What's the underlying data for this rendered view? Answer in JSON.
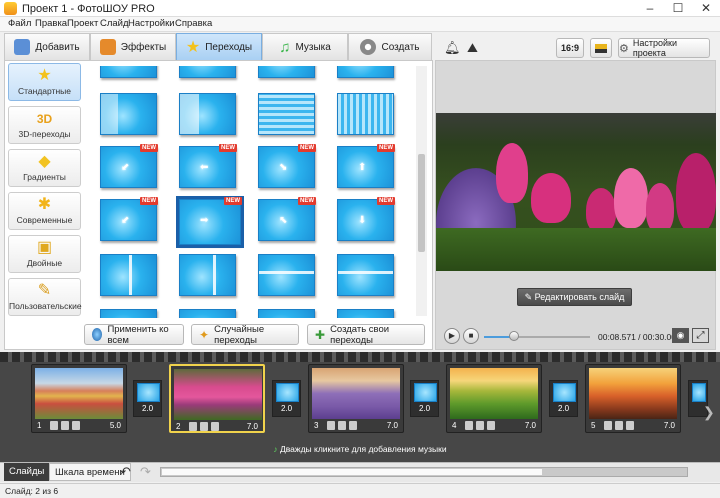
{
  "window": {
    "title": "Проект 1 - ФотоШОУ PRO",
    "minimize": "–",
    "maximize": "☐",
    "close": "✕"
  },
  "menu": [
    "Файл",
    "Правка",
    "Проект",
    "Слайд",
    "Настройки",
    "Справка"
  ],
  "tabs": [
    {
      "label": "Добавить",
      "icon": "add-photo-icon",
      "color": "#5b8fd6"
    },
    {
      "label": "Эффекты",
      "icon": "palette-icon",
      "color": "#e58a2b"
    },
    {
      "label": "Переходы",
      "icon": "star-icon",
      "color": "#f3c21c"
    },
    {
      "label": "Музыка",
      "icon": "music-note-icon",
      "color": "#39b54a"
    },
    {
      "label": "Создать",
      "icon": "film-reel-icon",
      "color": "#8a8a8a"
    }
  ],
  "categories": [
    {
      "label": "Стандартные",
      "icon": "★"
    },
    {
      "label": "3D-переходы",
      "icon": "3D"
    },
    {
      "label": "Градиенты",
      "icon": "◆"
    },
    {
      "label": "Современные",
      "icon": "✱"
    },
    {
      "label": "Двойные",
      "icon": "▣"
    },
    {
      "label": "Пользовательские",
      "icon": "✎"
    }
  ],
  "new_badge": "NEW",
  "transition_buttons": {
    "apply_all": "Применить ко всем",
    "random": "Случайные переходы",
    "create_own": "Создать свои переходы"
  },
  "right_toolbar": {
    "aspect": "16:9",
    "settings": "Настройки проекта"
  },
  "edit_slide": "Редактировать слайд",
  "player": {
    "time": "00:08.571 / 00:30.000",
    "progress": 0.2857
  },
  "slides": [
    {
      "num": "1",
      "duration": "5.0",
      "theme": "houses",
      "transition": "2.0"
    },
    {
      "num": "2",
      "duration": "7.0",
      "theme": "tulips",
      "transition": "2.0",
      "selected": true
    },
    {
      "num": "3",
      "duration": "7.0",
      "theme": "lavender",
      "transition": "2.0"
    },
    {
      "num": "4",
      "duration": "7.0",
      "theme": "hills",
      "transition": "2.0"
    },
    {
      "num": "5",
      "duration": "7.0",
      "theme": "sunset"
    }
  ],
  "music_hint": "Дважды кликните для добавления музыки",
  "bottom_tabs": {
    "slides": "Слайды",
    "timeline": "Шкала времени"
  },
  "status": "Слайд: 2 из 6",
  "colors": {
    "accent": "#1b8fd6",
    "selection": "#f1d34c",
    "new_badge": "#e33b2e"
  }
}
